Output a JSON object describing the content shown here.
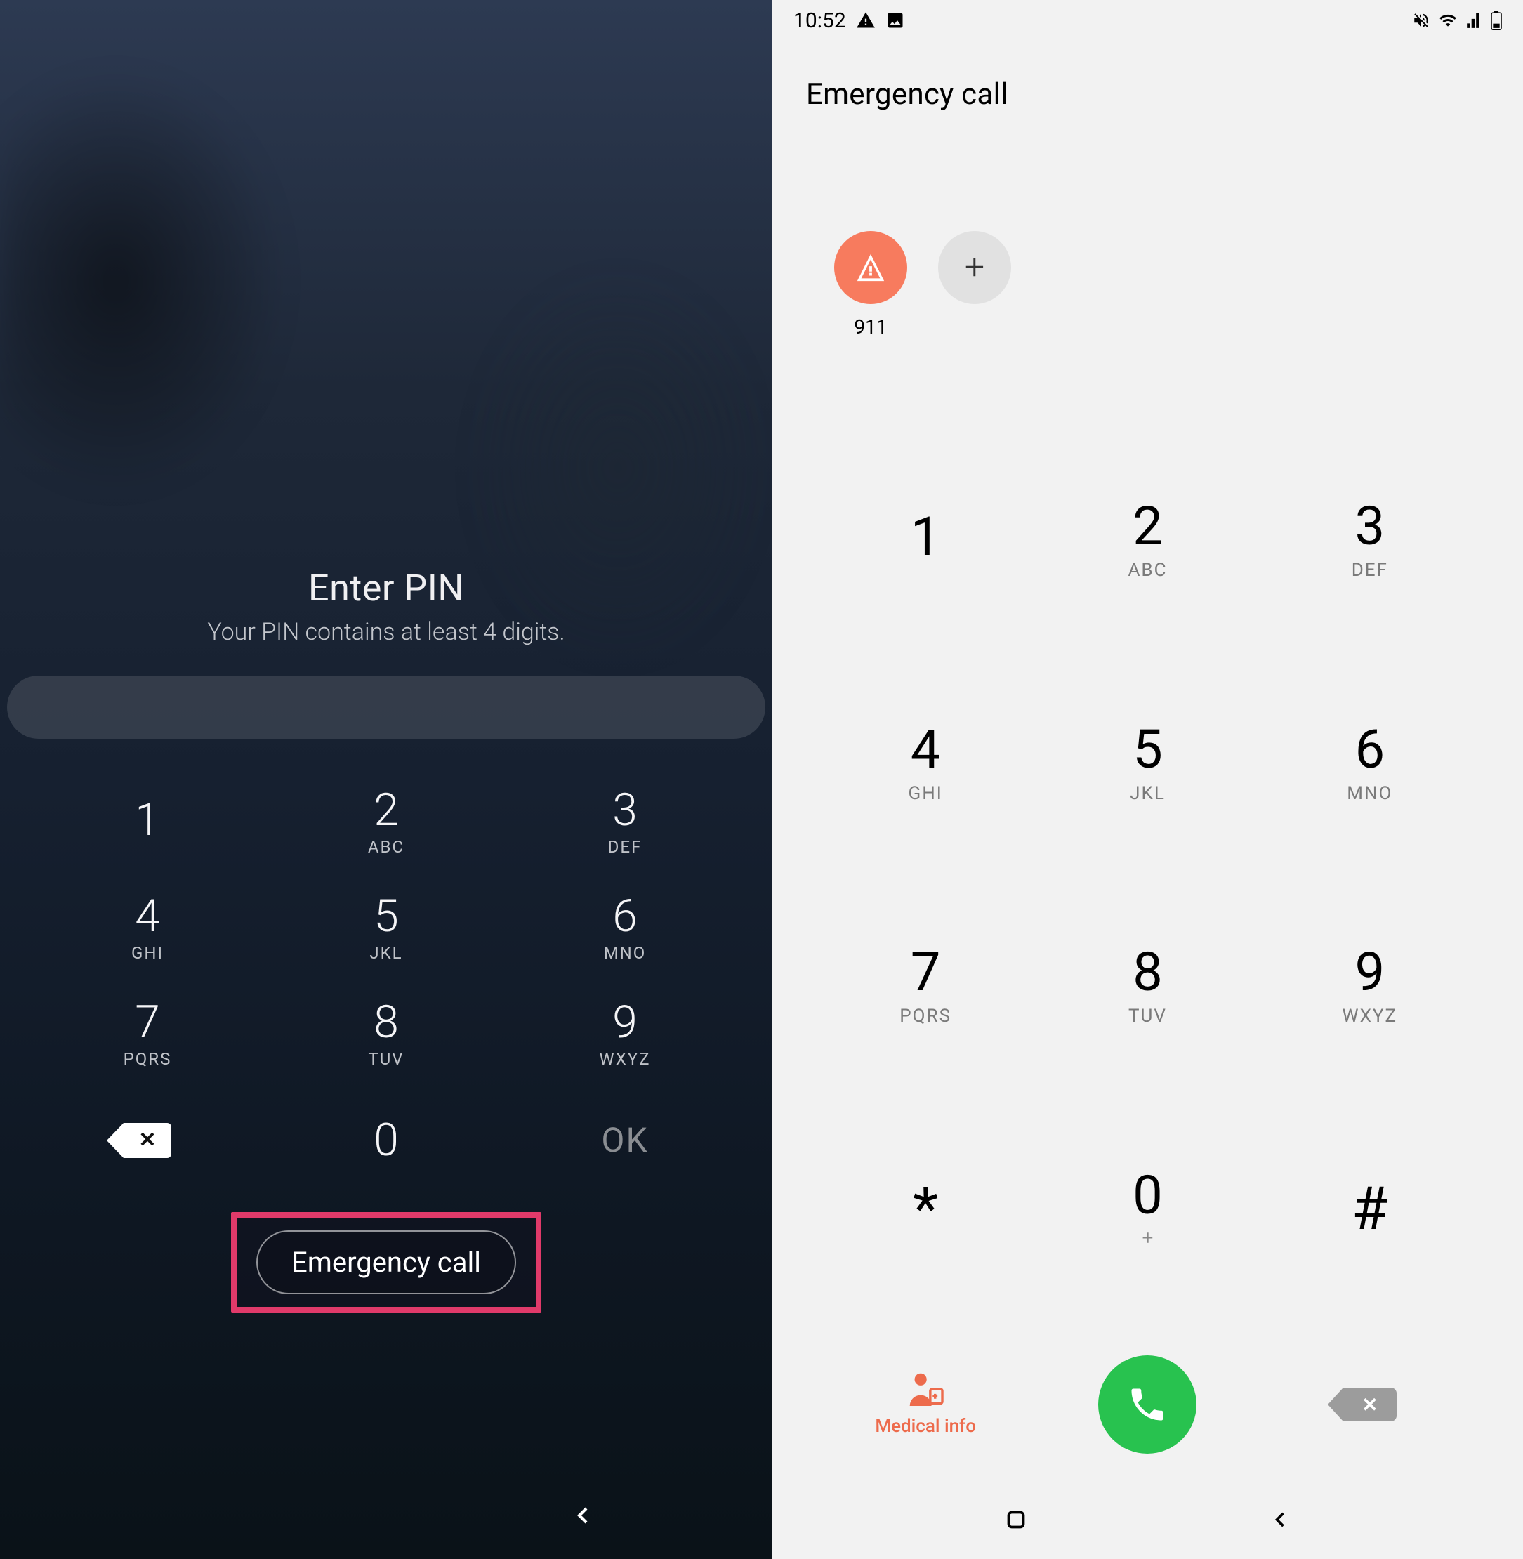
{
  "lock": {
    "title": "Enter PIN",
    "subtitle": "Your PIN contains at least 4 digits.",
    "emergency_label": "Emergency call",
    "ok_label": "OK",
    "keys": [
      {
        "digit": "1",
        "letters": ""
      },
      {
        "digit": "2",
        "letters": "ABC"
      },
      {
        "digit": "3",
        "letters": "DEF"
      },
      {
        "digit": "4",
        "letters": "GHI"
      },
      {
        "digit": "5",
        "letters": "JKL"
      },
      {
        "digit": "6",
        "letters": "MNO"
      },
      {
        "digit": "7",
        "letters": "PQRS"
      },
      {
        "digit": "8",
        "letters": "TUV"
      },
      {
        "digit": "9",
        "letters": "WXYZ"
      },
      {
        "digit": "0",
        "letters": ""
      }
    ]
  },
  "dialer": {
    "status": {
      "time": "10:52"
    },
    "title": "Emergency call",
    "contacts": {
      "emergency_number": "911"
    },
    "medical_info_label": "Medical info",
    "keys": [
      {
        "digit": "1",
        "letters": ""
      },
      {
        "digit": "2",
        "letters": "ABC"
      },
      {
        "digit": "3",
        "letters": "DEF"
      },
      {
        "digit": "4",
        "letters": "GHI"
      },
      {
        "digit": "5",
        "letters": "JKL"
      },
      {
        "digit": "6",
        "letters": "MNO"
      },
      {
        "digit": "7",
        "letters": "PQRS"
      },
      {
        "digit": "8",
        "letters": "TUV"
      },
      {
        "digit": "9",
        "letters": "WXYZ"
      }
    ],
    "star": "*",
    "zero": {
      "digit": "0",
      "sub": "+"
    },
    "hash": "#"
  }
}
